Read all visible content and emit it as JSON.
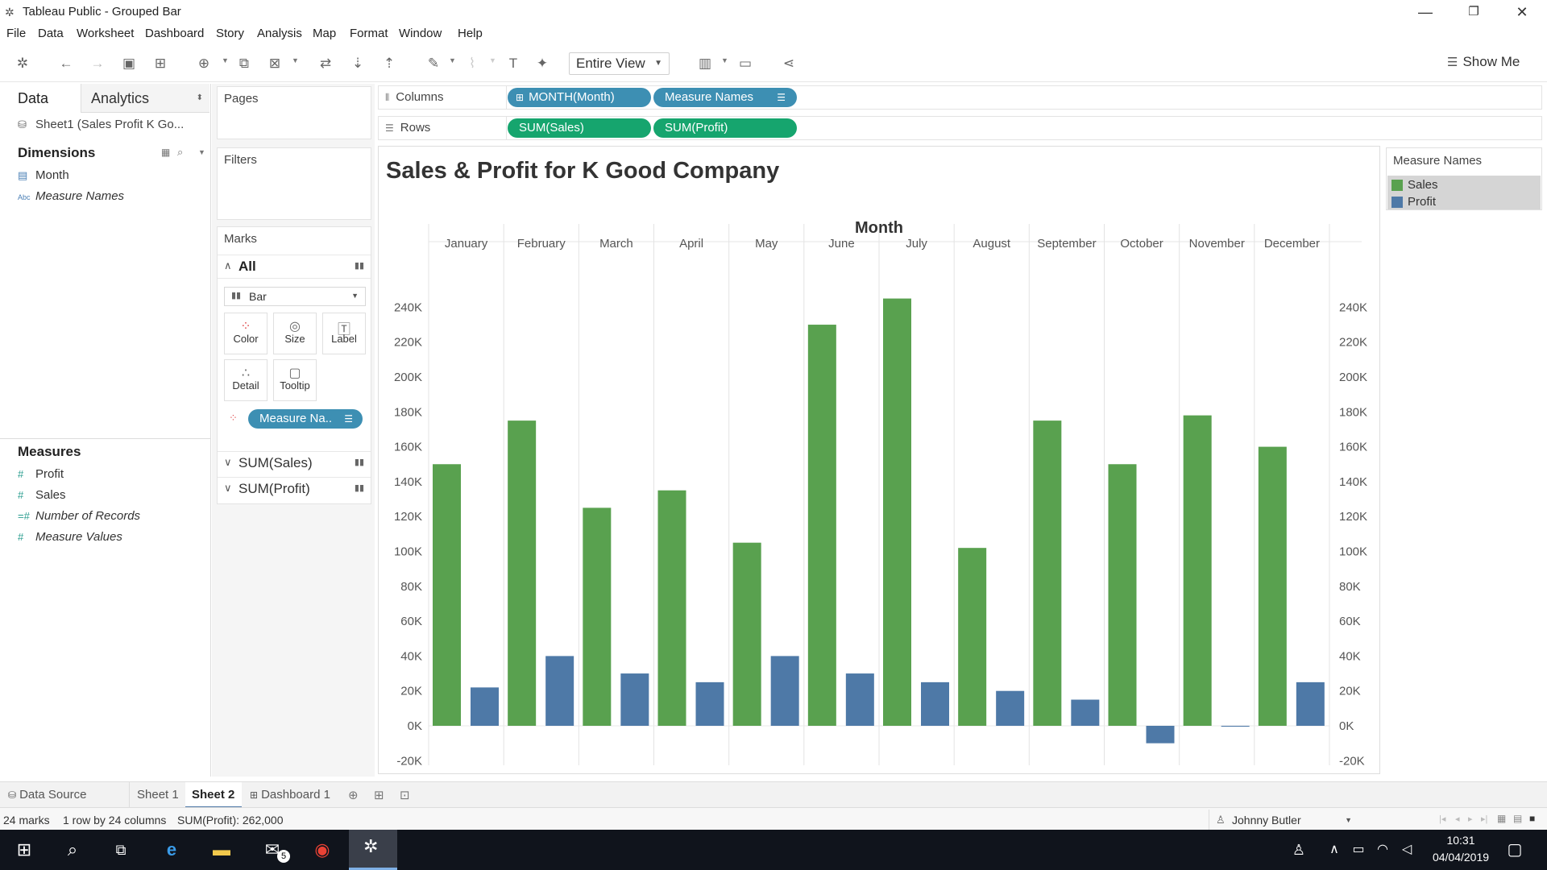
{
  "app": {
    "title": "Tableau Public - Grouped Bar"
  },
  "window_controls": {
    "minimize": "—",
    "restore": "❐",
    "close": "✕"
  },
  "menu": [
    "File",
    "Data",
    "Worksheet",
    "Dashboard",
    "Story",
    "Analysis",
    "Map",
    "Format",
    "Window",
    "Help"
  ],
  "toolbar": {
    "fit_mode": "Entire View",
    "show_me": "Show Me"
  },
  "data_pane": {
    "tab_data": "Data",
    "tab_analytics": "Analytics",
    "datasource": "Sheet1 (Sales Profit K Go...",
    "dimensions_header": "Dimensions",
    "dimensions": [
      {
        "icon": "date-icon",
        "label": "Month"
      },
      {
        "icon": "abc-icon",
        "label": "Measure Names"
      }
    ],
    "measures_header": "Measures",
    "measures": [
      "Profit",
      "Sales",
      "Number of Records",
      "Measure Values"
    ]
  },
  "cards": {
    "pages": "Pages",
    "filters": "Filters",
    "marks": "Marks",
    "marks_all": "All",
    "mark_type": "Bar",
    "buttons": [
      "Color",
      "Size",
      "Label",
      "Detail",
      "Tooltip"
    ],
    "color_pill": "Measure Na..",
    "sub_marks": [
      "SUM(Sales)",
      "SUM(Profit)"
    ]
  },
  "shelves": {
    "columns_label": "Columns",
    "rows_label": "Rows",
    "columns_pills": [
      "MONTH(Month)",
      "Measure Names"
    ],
    "rows_pills": [
      "SUM(Sales)",
      "SUM(Profit)"
    ]
  },
  "view": {
    "title": "Sales & Profit for K Good Company"
  },
  "legend": {
    "title": "Measure Names",
    "items": [
      {
        "label": "Sales",
        "color": "#59a14f"
      },
      {
        "label": "Profit",
        "color": "#4e79a7"
      }
    ]
  },
  "chart_data": {
    "type": "bar",
    "title": "",
    "xlabel": "Month",
    "ylabel": "",
    "categories": [
      "January",
      "February",
      "March",
      "April",
      "May",
      "June",
      "July",
      "August",
      "September",
      "October",
      "November",
      "December"
    ],
    "series": [
      {
        "name": "Sales",
        "color": "#59a14f",
        "values": [
          150000,
          175000,
          125000,
          135000,
          105000,
          230000,
          245000,
          102000,
          175000,
          150000,
          178000,
          160000
        ]
      },
      {
        "name": "Profit",
        "color": "#4e79a7",
        "values": [
          22000,
          40000,
          30000,
          25000,
          40000,
          30000,
          25000,
          20000,
          15000,
          -10000,
          -500,
          25000
        ]
      }
    ],
    "ylim": [
      -20000,
      240000
    ],
    "yticks": [
      "-20K",
      "0K",
      "20K",
      "40K",
      "60K",
      "80K",
      "100K",
      "120K",
      "140K",
      "160K",
      "180K",
      "200K",
      "220K",
      "240K"
    ],
    "ytick_values": [
      -20000,
      0,
      20000,
      40000,
      60000,
      80000,
      100000,
      120000,
      140000,
      160000,
      180000,
      200000,
      220000,
      240000
    ],
    "grid": true,
    "dual_axis_labels": true
  },
  "sheet_tabs": {
    "data_source": "Data Source",
    "sheets": [
      "Sheet 1",
      "Sheet 2",
      "Dashboard 1"
    ],
    "active": "Sheet 2"
  },
  "status": {
    "marks": "24 marks",
    "rows_cols": "1 row by 24 columns",
    "sum": "SUM(Profit): 262,000",
    "user": "Johnny Butler"
  },
  "taskbar": {
    "time": "10:31",
    "date": "04/04/2019",
    "mail_badge": "5"
  }
}
